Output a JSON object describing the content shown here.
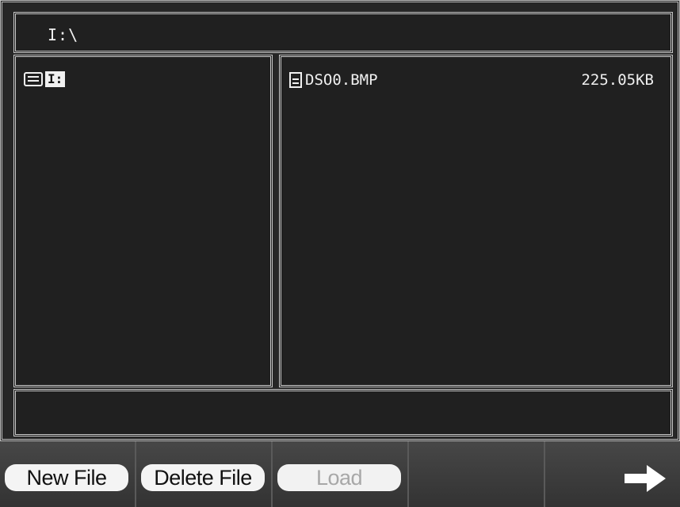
{
  "path_bar": {
    "path": "I:\\"
  },
  "tree": {
    "drive_label": "I:"
  },
  "files": [
    {
      "name": "DSO0.BMP",
      "size": "225.05KB"
    }
  ],
  "status_text": "",
  "softkeys": {
    "new_file": "New File",
    "delete_file": "Delete File",
    "load": "Load",
    "next_icon": "right-arrow-icon"
  }
}
